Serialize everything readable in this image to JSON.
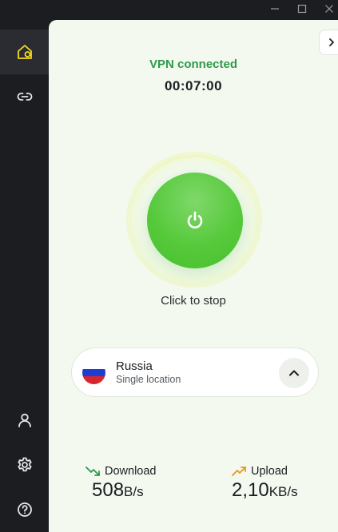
{
  "window": {
    "controls": [
      {
        "name": "minimize-button",
        "icon": "minimize-icon"
      },
      {
        "name": "maximize-button",
        "icon": "maximize-icon"
      },
      {
        "name": "close-button",
        "icon": "close-icon"
      }
    ]
  },
  "sidebar": {
    "items": [
      {
        "name": "home",
        "icon": "home-icon",
        "active": true
      },
      {
        "name": "link",
        "icon": "link-icon",
        "active": false
      },
      {
        "name": "account",
        "icon": "user-icon",
        "active": false
      },
      {
        "name": "settings",
        "icon": "gear-icon",
        "active": false
      },
      {
        "name": "help",
        "icon": "help-icon",
        "active": false
      }
    ],
    "accent_color": "#f2dc1f"
  },
  "main": {
    "status": "VPN connected",
    "timer": "00:07:00",
    "power_hint": "Click to stop",
    "location": {
      "country": "Russia",
      "mode": "Single location",
      "flag_colors": [
        "#ffffff",
        "#1c3fcf",
        "#d8262f"
      ]
    },
    "stats": {
      "download": {
        "label": "Download",
        "value": "508",
        "unit": "B/s",
        "icon": "download-trend-icon",
        "color": "#2e9a49"
      },
      "upload": {
        "label": "Upload",
        "value": "2,10",
        "unit": "KB/s",
        "icon": "upload-trend-icon",
        "color": "#e8951e"
      }
    },
    "colors": {
      "connected": "#2e9a49",
      "power_button": "#56c93b",
      "background": "#f3f9ef"
    }
  }
}
